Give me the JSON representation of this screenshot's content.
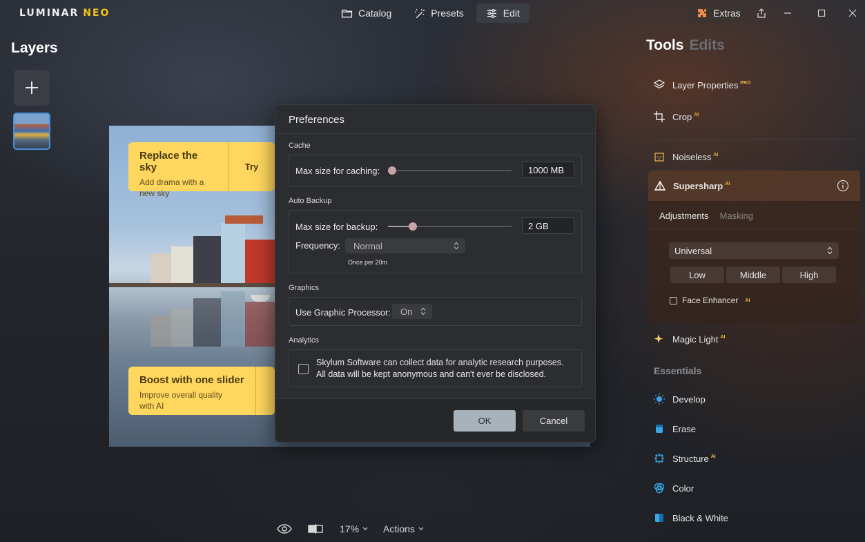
{
  "app": {
    "logo_main": "LUMINAR",
    "logo_accent": "NEO",
    "accent_color": "#f0c419"
  },
  "nav": {
    "tabs": [
      {
        "label": "Catalog",
        "icon": "folder-icon"
      },
      {
        "label": "Presets",
        "icon": "magic-wand-icon"
      },
      {
        "label": "Edit",
        "icon": "sliders-icon",
        "active": true
      }
    ],
    "extras_label": "Extras"
  },
  "layers": {
    "title": "Layers"
  },
  "canvas": {
    "promo_top": {
      "title": "Replace the sky",
      "subtitle": "Add drama with a new sky",
      "action": "Try"
    },
    "promo_bottom": {
      "title": "Boost with one slider",
      "subtitle": "Improve overall quality with AI"
    }
  },
  "bottombar": {
    "zoom": "17%",
    "actions": "Actions"
  },
  "tools_panel": {
    "tab_tools": "Tools",
    "tab_edits": "Edits",
    "items": [
      {
        "label": "Layer Properties",
        "badge": "PRO"
      },
      {
        "label": "Crop",
        "badge": "AI"
      },
      {
        "label": "Noiseless",
        "badge": "AI"
      },
      {
        "label": "Magic Light",
        "badge": "AI"
      }
    ],
    "supersharp": {
      "label": "Supersharp",
      "badge": "AI",
      "subtab_adjustments": "Adjustments",
      "subtab_masking": "Masking",
      "mode": "Universal",
      "levels": [
        "Low",
        "Middle",
        "High"
      ],
      "face_enhancer": "Face Enhancer",
      "face_badge": "AI"
    },
    "essentials_label": "Essentials",
    "essentials": [
      {
        "label": "Develop",
        "badge": ""
      },
      {
        "label": "Erase",
        "badge": ""
      },
      {
        "label": "Structure",
        "badge": "AI"
      },
      {
        "label": "Color",
        "badge": ""
      },
      {
        "label": "Black & White",
        "badge": ""
      }
    ]
  },
  "dialog": {
    "title": "Preferences",
    "cache": {
      "section": "Cache",
      "label": "Max size for caching:",
      "value": "1000 MB",
      "slider_level": 0.0
    },
    "backup": {
      "section": "Auto Backup",
      "label": "Max size for backup:",
      "value": "2 GB",
      "slider_level": 0.2,
      "frequency_label": "Frequency:",
      "frequency_value": "Normal",
      "frequency_hint": "Once per 20m"
    },
    "graphics": {
      "section": "Graphics",
      "label": "Use Graphic Processor:",
      "value": "On"
    },
    "analytics": {
      "section": "Analytics",
      "text_line1": "Skylum Software can collect data for analytic research purposes.",
      "text_line2": "All data will be kept anonymous and can't ever be disclosed."
    },
    "ok_label": "OK",
    "cancel_label": "Cancel"
  }
}
